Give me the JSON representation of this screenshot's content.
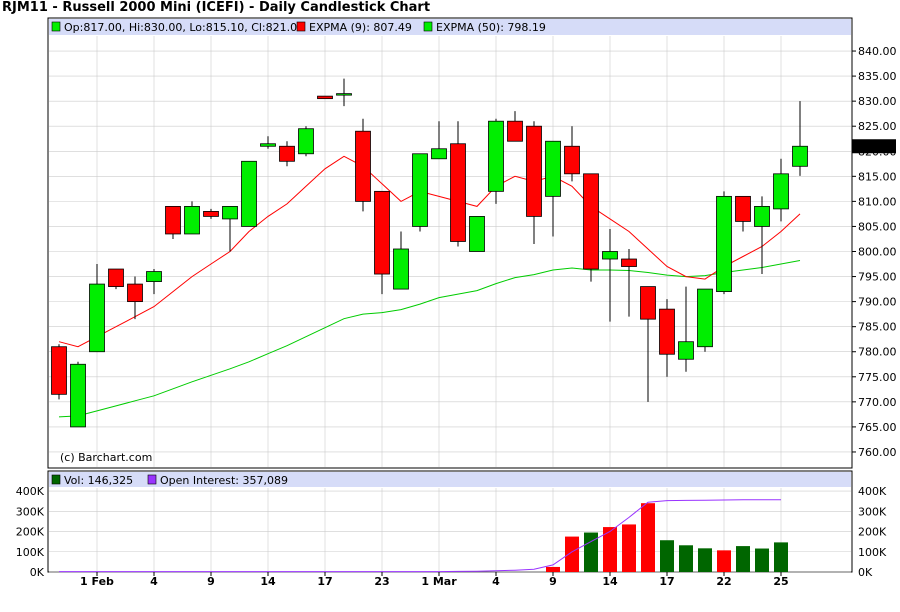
{
  "header": {
    "title": "RJM11 - Russell 2000 Mini (ICEFI) - Daily Candlestick Chart"
  },
  "legend": {
    "ohlc": "Op:817.00, Hi:830.00, Lo:815.10, Cl:821.00",
    "ema9": "EXPMA (9): 807.49",
    "ema50": "EXPMA (50): 798.19",
    "vol": "Vol: 146,325",
    "oi": "Open Interest: 357,089"
  },
  "copyright": "(c) Barchart.com",
  "colors": {
    "up": "#00ee00",
    "down": "#ff0000",
    "ema9": "#ff0000",
    "ema50": "#00cc00",
    "volUp": "#006600",
    "volDown": "#ff0000",
    "oi": "#9933ff",
    "panelBar": "#d6dcf8"
  },
  "chart_data": [
    {
      "type": "candlestick",
      "title": "RJM11 - Russell 2000 Mini (ICEFI) - Daily Candlestick Chart",
      "ylim": [
        757,
        843
      ],
      "yticks": [
        840,
        835,
        830,
        825,
        820,
        815,
        810,
        805,
        800,
        795,
        790,
        785,
        780,
        775,
        770,
        765,
        760
      ],
      "ytick_labels": [
        "840.00",
        "835.00",
        "830.00",
        "825.00",
        "820.00",
        "815.00",
        "810.00",
        "805.00",
        "800.00",
        "795.00",
        "790.00",
        "785.00",
        "780.00",
        "775.00",
        "770.00",
        "765.00",
        "760.00"
      ],
      "last_price_label": "821.00",
      "xtick_labels": [
        {
          "index": 2,
          "label": "1 Feb"
        },
        {
          "index": 5,
          "label": "4"
        },
        {
          "index": 8,
          "label": "9"
        },
        {
          "index": 11,
          "label": "14"
        },
        {
          "index": 14,
          "label": "17"
        },
        {
          "index": 17,
          "label": "23"
        },
        {
          "index": 20,
          "label": "1 Mar"
        },
        {
          "index": 23,
          "label": "4"
        },
        {
          "index": 26,
          "label": "9"
        },
        {
          "index": 29,
          "label": "14"
        },
        {
          "index": 32,
          "label": "17"
        },
        {
          "index": 35,
          "label": "22"
        },
        {
          "index": 38,
          "label": "25"
        }
      ],
      "candles": [
        {
          "o": 781.0,
          "h": 781.5,
          "l": 770.5,
          "c": 771.5
        },
        {
          "o": 765.0,
          "h": 778.0,
          "l": 765.0,
          "c": 777.5
        },
        {
          "o": 780.0,
          "h": 797.5,
          "l": 780.0,
          "c": 793.5
        },
        {
          "o": 796.5,
          "h": 796.5,
          "l": 792.5,
          "c": 793.0
        },
        {
          "o": 793.5,
          "h": 795.0,
          "l": 786.5,
          "c": 790.0
        },
        {
          "o": 794.0,
          "h": 796.5,
          "l": 791.5,
          "c": 796.0
        },
        {
          "o": 809.0,
          "h": 809.0,
          "l": 802.5,
          "c": 803.5
        },
        {
          "o": 803.5,
          "h": 810.0,
          "l": 803.5,
          "c": 809.0
        },
        {
          "o": 808.0,
          "h": 808.5,
          "l": 806.5,
          "c": 807.0
        },
        {
          "o": 806.5,
          "h": 809.0,
          "l": 800.0,
          "c": 809.0
        },
        {
          "o": 805.0,
          "h": 818.0,
          "l": 805.0,
          "c": 818.0
        },
        {
          "o": 821.0,
          "h": 823.0,
          "l": 820.5,
          "c": 821.5
        },
        {
          "o": 821.0,
          "h": 822.0,
          "l": 817.0,
          "c": 818.0
        },
        {
          "o": 819.5,
          "h": 825.0,
          "l": 819.0,
          "c": 824.5
        },
        {
          "o": 831.0,
          "h": 831.0,
          "l": 830.5,
          "c": 830.5
        },
        {
          "o": 831.5,
          "h": 834.5,
          "l": 829.0,
          "c": 831.5
        },
        {
          "o": 824.0,
          "h": 826.5,
          "l": 808.0,
          "c": 810.0
        },
        {
          "o": 812.0,
          "h": 812.0,
          "l": 791.5,
          "c": 795.5
        },
        {
          "o": 792.5,
          "h": 804.0,
          "l": 792.5,
          "c": 800.5
        },
        {
          "o": 805.0,
          "h": 819.0,
          "l": 804.0,
          "c": 819.5
        },
        {
          "o": 818.5,
          "h": 826.0,
          "l": 818.5,
          "c": 820.5
        },
        {
          "o": 821.5,
          "h": 826.0,
          "l": 801.0,
          "c": 802.0
        },
        {
          "o": 800.0,
          "h": 807.0,
          "l": 800.0,
          "c": 807.0
        },
        {
          "o": 812.0,
          "h": 826.5,
          "l": 809.5,
          "c": 826.0
        },
        {
          "o": 826.0,
          "h": 828.0,
          "l": 822.0,
          "c": 822.0
        },
        {
          "o": 825.0,
          "h": 826.0,
          "l": 801.5,
          "c": 807.0
        },
        {
          "o": 811.0,
          "h": 822.0,
          "l": 803.0,
          "c": 822.0
        },
        {
          "o": 821.0,
          "h": 825.0,
          "l": 814.0,
          "c": 815.5
        },
        {
          "o": 815.5,
          "h": 815.5,
          "l": 794.0,
          "c": 796.5
        },
        {
          "o": 798.5,
          "h": 804.5,
          "l": 786.0,
          "c": 800.0
        },
        {
          "o": 798.5,
          "h": 800.5,
          "l": 787.0,
          "c": 797.0
        },
        {
          "o": 793.0,
          "h": 793.0,
          "l": 770.0,
          "c": 786.5
        },
        {
          "o": 788.5,
          "h": 790.5,
          "l": 775.0,
          "c": 779.5
        },
        {
          "o": 778.5,
          "h": 793.0,
          "l": 776.0,
          "c": 782.0
        },
        {
          "o": 781.0,
          "h": 792.5,
          "l": 780.0,
          "c": 792.5
        },
        {
          "o": 792.0,
          "h": 812.0,
          "l": 791.5,
          "c": 811.0
        },
        {
          "o": 811.0,
          "h": 811.0,
          "l": 804.0,
          "c": 806.0
        },
        {
          "o": 805.0,
          "h": 811.0,
          "l": 795.5,
          "c": 809.0
        },
        {
          "o": 808.5,
          "h": 818.5,
          "l": 806.0,
          "c": 815.5
        },
        {
          "o": 817.0,
          "h": 830.0,
          "l": 815.1,
          "c": 821.0
        }
      ],
      "series": [
        {
          "name": "EXPMA (9)",
          "values": [
            782.0,
            781.0,
            783.0,
            785.0,
            787.0,
            789.0,
            792.0,
            795.0,
            797.5,
            800.0,
            804.0,
            807.0,
            809.5,
            813.0,
            816.5,
            819.0,
            817.0,
            813.5,
            810.0,
            812.0,
            811.0,
            810.0,
            809.0,
            813.0,
            815.0,
            814.0,
            815.0,
            813.0,
            809.0,
            806.5,
            804.0,
            800.5,
            797.0,
            795.0,
            794.5,
            797.0,
            799.0,
            801.0,
            804.0,
            807.5
          ]
        },
        {
          "name": "EXPMA (50)",
          "values": [
            767.0,
            767.2,
            768.2,
            769.2,
            770.2,
            771.2,
            772.6,
            774.0,
            775.3,
            776.6,
            778.0,
            779.6,
            781.2,
            783.0,
            784.8,
            786.6,
            787.5,
            787.8,
            788.4,
            789.5,
            790.8,
            791.5,
            792.2,
            793.6,
            794.8,
            795.4,
            796.3,
            796.7,
            796.3,
            796.3,
            796.2,
            795.8,
            795.3,
            795.0,
            795.2,
            795.8,
            796.3,
            796.8,
            797.5,
            798.2
          ]
        }
      ]
    },
    {
      "type": "bar",
      "title": "Volume / Open Interest",
      "ylim": [
        0,
        420000
      ],
      "ytick_labels": [
        "400K",
        "300K",
        "200K",
        "100K",
        "0K"
      ],
      "yticks": [
        400000,
        300000,
        200000,
        100000,
        0
      ],
      "volume": [
        0,
        0,
        0,
        0,
        0,
        0,
        0,
        0,
        0,
        0,
        0,
        0,
        0,
        0,
        0,
        0,
        0,
        0,
        0,
        0,
        0,
        0,
        0,
        0,
        0,
        0,
        25000,
        175000,
        195000,
        222000,
        235000,
        340000,
        157000,
        132000,
        117000,
        107000,
        128000,
        116000,
        146325
      ],
      "volume_up": [
        false,
        true,
        true,
        false,
        true,
        true,
        false,
        true,
        false,
        true,
        true,
        true,
        false,
        true,
        false,
        true,
        false,
        false,
        true,
        true,
        true,
        false,
        true,
        true,
        false,
        false,
        false,
        false,
        true,
        false,
        false,
        false,
        true,
        true,
        true,
        false,
        true,
        true,
        true
      ],
      "series": [
        {
          "name": "Open Interest",
          "values": [
            2000,
            2000,
            2000,
            2000,
            2000,
            2000,
            2000,
            2000,
            2000,
            2000,
            2000,
            2000,
            2000,
            2000,
            2000,
            2000,
            2000,
            2000,
            2000,
            2000,
            2000,
            3000,
            4000,
            6000,
            9000,
            14000,
            35000,
            100000,
            150000,
            200000,
            270000,
            345000,
            353000,
            354000,
            355000,
            356000,
            357000,
            357000,
            357089
          ]
        }
      ]
    }
  ]
}
